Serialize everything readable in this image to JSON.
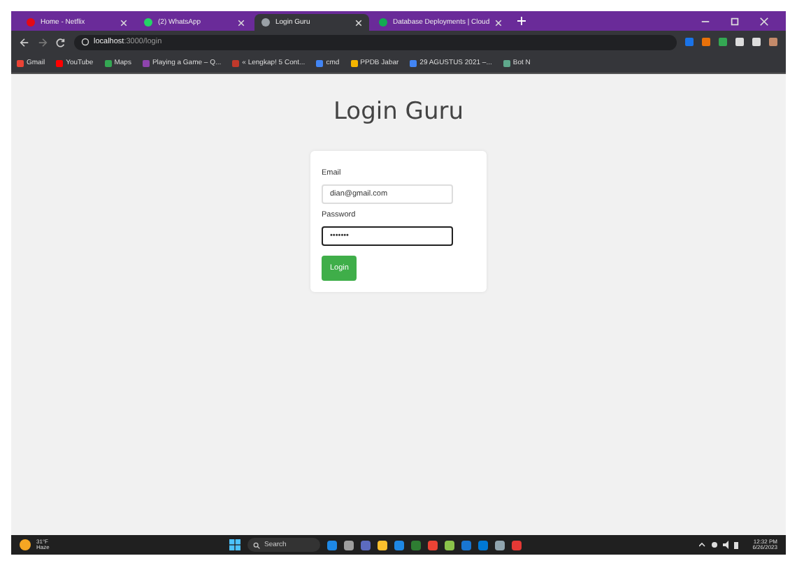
{
  "tabs": [
    {
      "title": "Home - Netflix",
      "color": "#e50914",
      "selected": false
    },
    {
      "title": "(2) WhatsApp",
      "color": "#25d366",
      "selected": false
    },
    {
      "title": "Login Guru",
      "color": "#9aa0a6",
      "selected": true
    },
    {
      "title": "Database Deployments | Cloud",
      "color": "#13aa52",
      "selected": false
    }
  ],
  "address": {
    "host": "localhost",
    "path": ":3000/login"
  },
  "bookmarks": [
    {
      "label": "Gmail",
      "color": "#ea4335"
    },
    {
      "label": "YouTube",
      "color": "#ff0000"
    },
    {
      "label": "Maps",
      "color": "#34a853"
    },
    {
      "label": "Playing a Game – Q...",
      "color": "#8e44ad"
    },
    {
      "label": "« Lengkap! 5 Cont...",
      "color": "#c0392b"
    },
    {
      "label": "cmd",
      "color": "#4285f4"
    },
    {
      "label": "PPDB Jabar",
      "color": "#f4b400"
    },
    {
      "label": "29 AGUSTUS 2021 –...",
      "color": "#4285f4"
    },
    {
      "label": "Bot N",
      "color": "#5fa88c"
    }
  ],
  "page": {
    "heading": "Login Guru",
    "email_label": "Email",
    "email_value": "dian@gmail.com",
    "password_label": "Password",
    "password_value": "•••••••",
    "button": "Login"
  },
  "taskbar": {
    "weather_temp": "31°F",
    "weather_desc": "Haze",
    "search": "Search",
    "time": "12:32 PM",
    "date": "6/26/2023"
  }
}
